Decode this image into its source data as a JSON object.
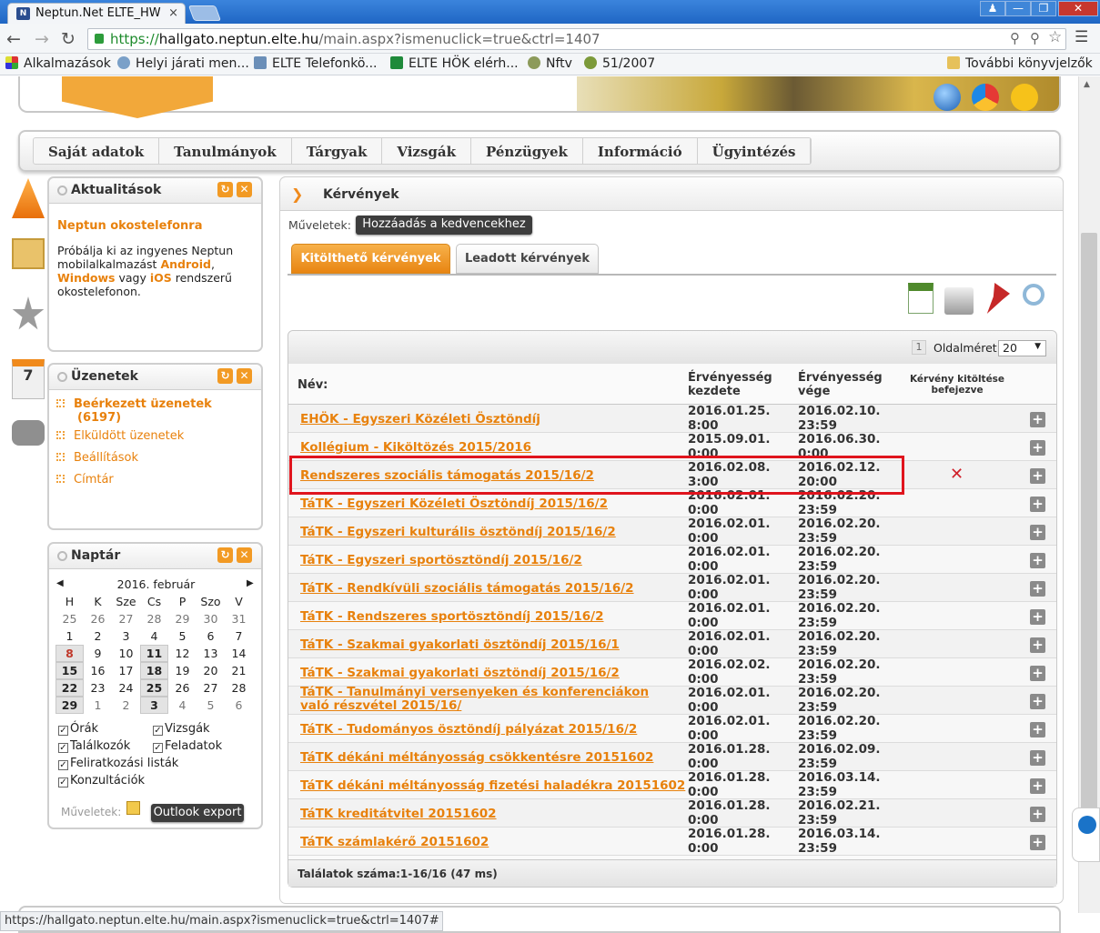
{
  "browser": {
    "tab_title": "Neptun.Net ELTE_HW",
    "tab_close": "×",
    "url_scheme": "https://",
    "url_host": "hallgato.neptun.elte.hu",
    "url_path": "/main.aspx?ismenuclick=true&ctrl=1407",
    "bookmarks": [
      "Alkalmazások",
      "Helyi járati men...",
      "ELTE Telefonkö...",
      "ELTE HÖK elérh...",
      "Nftv",
      "51/2007"
    ],
    "other_bookmarks": "További könyvjelzők",
    "status_url": "https://hallgato.neptun.elte.hu/main.aspx?ismenuclick=true&ctrl=1407#"
  },
  "menu": [
    "Saját adatok",
    "Tanulmányok",
    "Tárgyak",
    "Vizsgák",
    "Pénzügyek",
    "Információ",
    "Ügyintézés"
  ],
  "news": {
    "title": "Aktualitások",
    "heading": "Neptun okostelefonra",
    "t1": "Próbálja ki az ingyenes Neptun",
    "t2a": "mobilalkalmazást ",
    "android": "Android",
    "t2b": ",",
    "windows": "Windows",
    "t3a": " vagy ",
    "ios": "iOS",
    "t3b": " rendszerű",
    "t4": "okostelefonon."
  },
  "messages": {
    "title": "Üzenetek",
    "items": [
      "Beérkezett üzenetek",
      "(6197)",
      "Elküldött üzenetek",
      "Beállítások",
      "Címtár"
    ]
  },
  "calendar": {
    "title": "Naptár",
    "month": "2016. február",
    "days": [
      "H",
      "K",
      "Sze",
      "Cs",
      "P",
      "Szo",
      "V"
    ],
    "weeks": [
      [
        "25",
        "26",
        "27",
        "28",
        "29",
        "30",
        "31"
      ],
      [
        "1",
        "2",
        "3",
        "4",
        "5",
        "6",
        "7"
      ],
      [
        "8",
        "9",
        "10",
        "11",
        "12",
        "13",
        "14"
      ],
      [
        "15",
        "16",
        "17",
        "18",
        "19",
        "20",
        "21"
      ],
      [
        "22",
        "23",
        "24",
        "25",
        "26",
        "27",
        "28"
      ],
      [
        "29",
        "1",
        "2",
        "3",
        "4",
        "5",
        "6"
      ]
    ],
    "checkboxes": [
      "Órák",
      "Vizsgák",
      "Találkozók",
      "Feladatok",
      "Feliratkozási listák",
      "Konzultációk"
    ],
    "actions_label": "Műveletek:",
    "export_button": "Outlook export"
  },
  "main": {
    "title": "Kérvények",
    "actions_label": "Műveletek:",
    "favorites_button": "Hozzáadás a kedvencekhez",
    "tab_active": "Kitölthető kérvények",
    "tab_inactive": "Leadott kérvények",
    "page_number": "1",
    "page_size_label": "Oldalméret",
    "page_size_value": "20",
    "col_name": "Név:",
    "col_start": "Érvényesség kezdete",
    "col_end": "Érvényesség vége",
    "col_done": "Kérvény kitöltése befejezve",
    "rows": [
      {
        "name": "EHÖK - Egyszeri Közéleti Ösztöndíj",
        "start": "2016.01.25. 8:00",
        "end": "2016.02.10. 23:59",
        "done": ""
      },
      {
        "name": "Kollégium - Kiköltözés 2015/2016",
        "start": "2015.09.01. 0:00",
        "end": "2016.06.30. 0:00",
        "done": ""
      },
      {
        "name": "Rendszeres szociális támogatás 2015/16/2",
        "start": "2016.02.08. 3:00",
        "end": "2016.02.12. 20:00",
        "done": "✕"
      },
      {
        "name": "TáTK - Egyszeri Közéleti Ösztöndíj 2015/16/2",
        "start": "2016.02.01. 0:00",
        "end": "2016.02.20. 23:59",
        "done": ""
      },
      {
        "name": "TáTK - Egyszeri kulturális ösztöndíj 2015/16/2",
        "start": "2016.02.01. 0:00",
        "end": "2016.02.20. 23:59",
        "done": ""
      },
      {
        "name": "TáTK - Egyszeri sportösztöndíj 2015/16/2",
        "start": "2016.02.01. 0:00",
        "end": "2016.02.20. 23:59",
        "done": ""
      },
      {
        "name": "TáTK - Rendkívüli szociális támogatás 2015/16/2",
        "start": "2016.02.01. 0:00",
        "end": "2016.02.20. 23:59",
        "done": ""
      },
      {
        "name": "TáTK - Rendszeres sportösztöndíj 2015/16/2",
        "start": "2016.02.01. 0:00",
        "end": "2016.02.20. 23:59",
        "done": ""
      },
      {
        "name": "TáTK - Szakmai gyakorlati ösztöndíj 2015/16/1",
        "start": "2016.02.01. 0:00",
        "end": "2016.02.20. 23:59",
        "done": ""
      },
      {
        "name": "TáTK - Szakmai gyakorlati ösztöndíj 2015/16/2",
        "start": "2016.02.02. 0:00",
        "end": "2016.02.20. 23:59",
        "done": ""
      },
      {
        "name": "TáTK - Tanulmányi versenyeken és konferenciákon való részvétel 2015/16/",
        "start": "2016.02.01. 0:00",
        "end": "2016.02.20. 23:59",
        "done": ""
      },
      {
        "name": "TáTK - Tudományos ösztöndíj pályázat 2015/16/2",
        "start": "2016.02.01. 0:00",
        "end": "2016.02.20. 23:59",
        "done": ""
      },
      {
        "name": "TáTK dékáni méltányosság csökkentésre 20151602",
        "start": "2016.01.28. 0:00",
        "end": "2016.02.09. 23:59",
        "done": ""
      },
      {
        "name": "TáTK dékáni méltányosság fizetési haladékra 20151602",
        "start": "2016.01.28. 0:00",
        "end": "2016.03.14. 23:59",
        "done": ""
      },
      {
        "name": "TáTK kreditátvitel 20151602",
        "start": "2016.01.28. 0:00",
        "end": "2016.02.21. 23:59",
        "done": ""
      },
      {
        "name": "TáTK számlakérő 20151602",
        "start": "2016.01.28. 0:00",
        "end": "2016.03.14. 23:59",
        "done": ""
      }
    ],
    "footer": "Találatok száma:1-16/16 (47 ms)"
  }
}
